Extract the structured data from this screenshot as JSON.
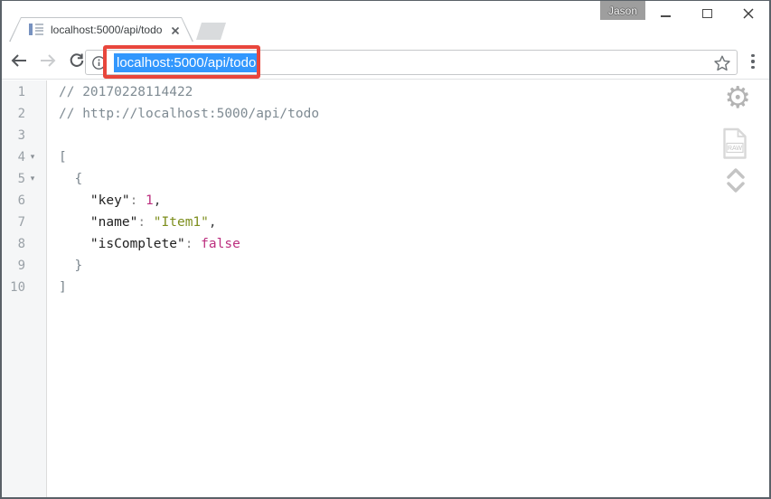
{
  "window": {
    "profile_badge": "Jason"
  },
  "tabs": [
    {
      "title": "localhost:5000/api/todo"
    }
  ],
  "toolbar": {
    "url": "localhost:5000/api/todo"
  },
  "annotation": {
    "description": "red highlight box around selected url",
    "color": "#e8463c"
  },
  "colors": {
    "url_selection_background": "#3297fd",
    "comment": "#7f8b93",
    "key": "#1f1f1f",
    "string": "#7d8e1d",
    "number_boolean": "#bc2f7f",
    "gutter_background": "#f5f6f7"
  },
  "viewer": {
    "raw_label": "RAW",
    "collapse_glyph": "▾",
    "gear_glyph": "⚙",
    "lines": [
      {
        "num": 1,
        "collapsible": false,
        "segments": [
          {
            "t": "// 20170228114422",
            "c": "comment"
          }
        ]
      },
      {
        "num": 2,
        "collapsible": false,
        "segments": [
          {
            "t": "// http://localhost:5000/api/todo",
            "c": "comment"
          }
        ]
      },
      {
        "num": 3,
        "collapsible": false,
        "segments": []
      },
      {
        "num": 4,
        "collapsible": true,
        "segments": [
          {
            "t": "[",
            "c": "brace"
          }
        ]
      },
      {
        "num": 5,
        "collapsible": true,
        "segments": [
          {
            "t": "  {",
            "c": "brace"
          }
        ]
      },
      {
        "num": 6,
        "collapsible": false,
        "segments": [
          {
            "t": "    ",
            "c": "plain"
          },
          {
            "t": "\"key\"",
            "c": "key"
          },
          {
            "t": ": ",
            "c": "punct"
          },
          {
            "t": "1",
            "c": "num"
          },
          {
            "t": ",",
            "c": "comma"
          }
        ]
      },
      {
        "num": 7,
        "collapsible": false,
        "segments": [
          {
            "t": "    ",
            "c": "plain"
          },
          {
            "t": "\"name\"",
            "c": "key"
          },
          {
            "t": ": ",
            "c": "punct"
          },
          {
            "t": "\"Item1\"",
            "c": "str"
          },
          {
            "t": ",",
            "c": "comma"
          }
        ]
      },
      {
        "num": 8,
        "collapsible": false,
        "segments": [
          {
            "t": "    ",
            "c": "plain"
          },
          {
            "t": "\"isComplete\"",
            "c": "key"
          },
          {
            "t": ": ",
            "c": "punct"
          },
          {
            "t": "false",
            "c": "bool"
          }
        ]
      },
      {
        "num": 9,
        "collapsible": false,
        "segments": [
          {
            "t": "  }",
            "c": "brace"
          }
        ]
      },
      {
        "num": 10,
        "collapsible": false,
        "segments": [
          {
            "t": "]",
            "c": "brace"
          }
        ]
      }
    ]
  }
}
